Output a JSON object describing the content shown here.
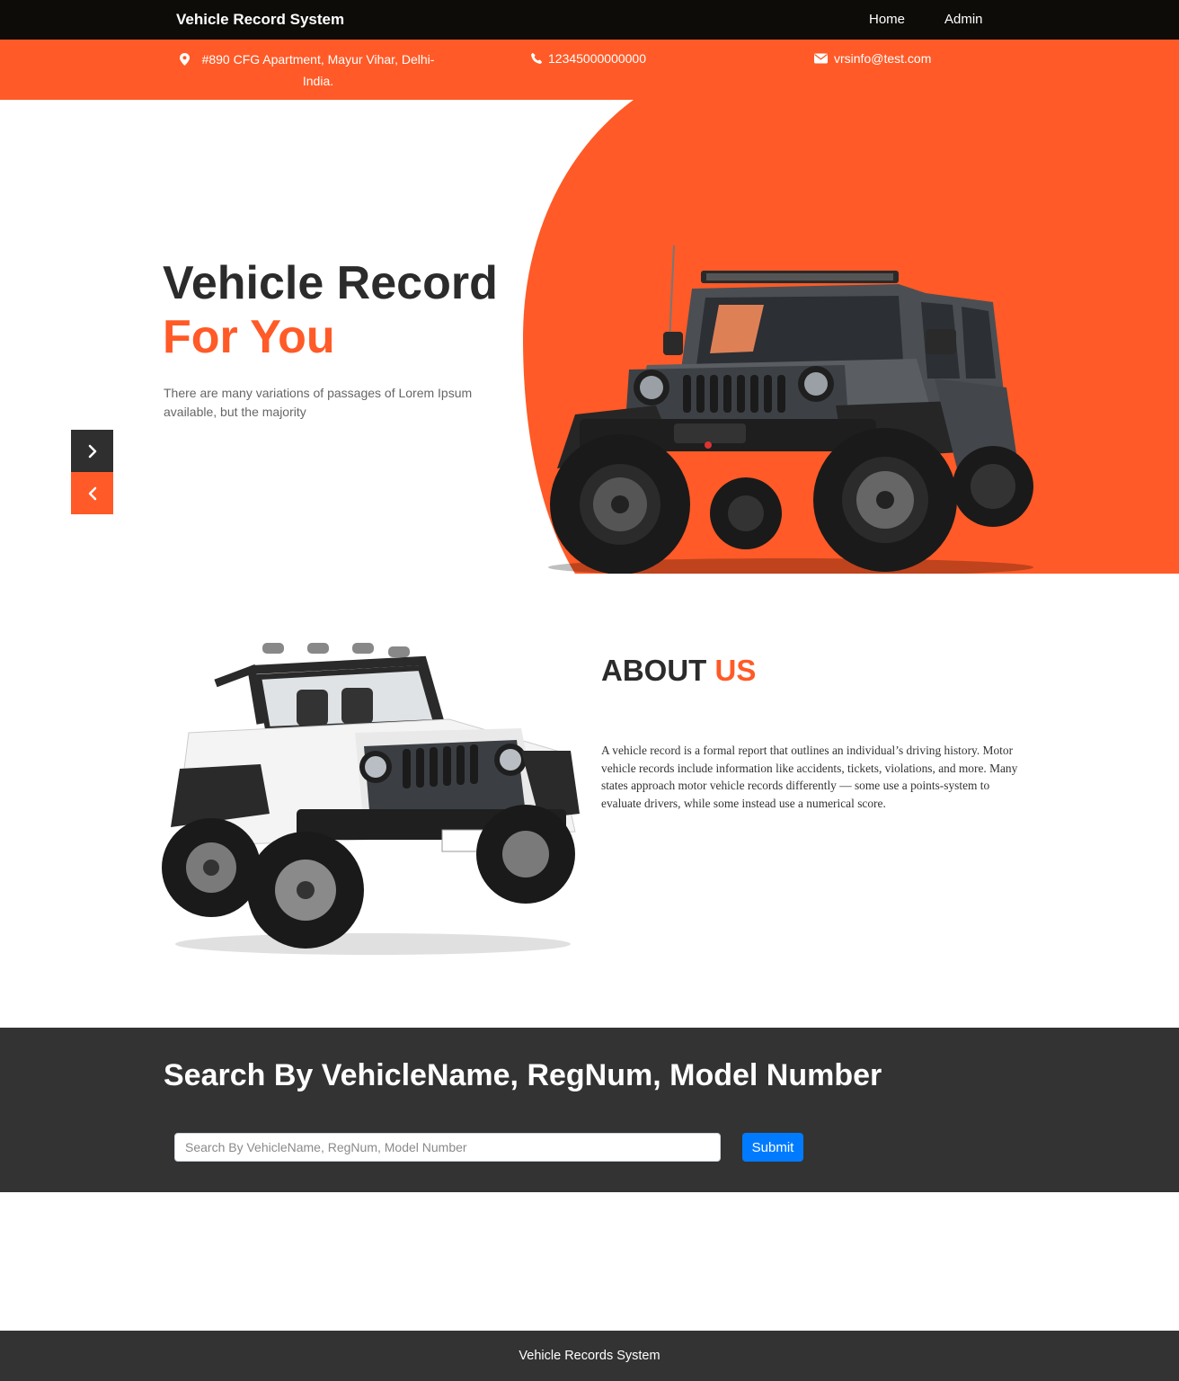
{
  "navbar": {
    "brand": "Vehicle Record System",
    "links": [
      {
        "label": "Home"
      },
      {
        "label": "Admin"
      }
    ]
  },
  "contact": {
    "address": "#890 CFG Apartment, Mayur Vihar, Delhi-India.",
    "phone": "12345000000000",
    "email": "vrsinfo@test.com"
  },
  "hero": {
    "title_line1": "Vehicle Record",
    "title_line2": "For You",
    "description": "There are many variations of passages of Lorem Ipsum available, but the majority"
  },
  "about": {
    "title_part1": "ABOUT",
    "title_part2": "US",
    "text": "A vehicle record is a formal report that outlines an individual’s driving history. Motor vehicle records include information like accidents, tickets, violations, and more. Many states approach motor vehicle records differently — some use a points-system to evaluate drivers, while some instead use a numerical score."
  },
  "search": {
    "title": "Search By VehicleName, RegNum, Model Number",
    "placeholder": "Search By VehicleName, RegNum, Model Number",
    "value": "",
    "submit_label": "Submit"
  },
  "footer": {
    "text": "Vehicle Records System"
  },
  "colors": {
    "accent": "#ff5a27",
    "navbar": "#0e0c09",
    "dark_section": "#333333",
    "button": "#007bff"
  },
  "icons": {
    "address": "map-marker-icon",
    "phone": "phone-icon",
    "email": "envelope-icon",
    "next": "chevron-right-icon",
    "prev": "chevron-left-icon"
  }
}
